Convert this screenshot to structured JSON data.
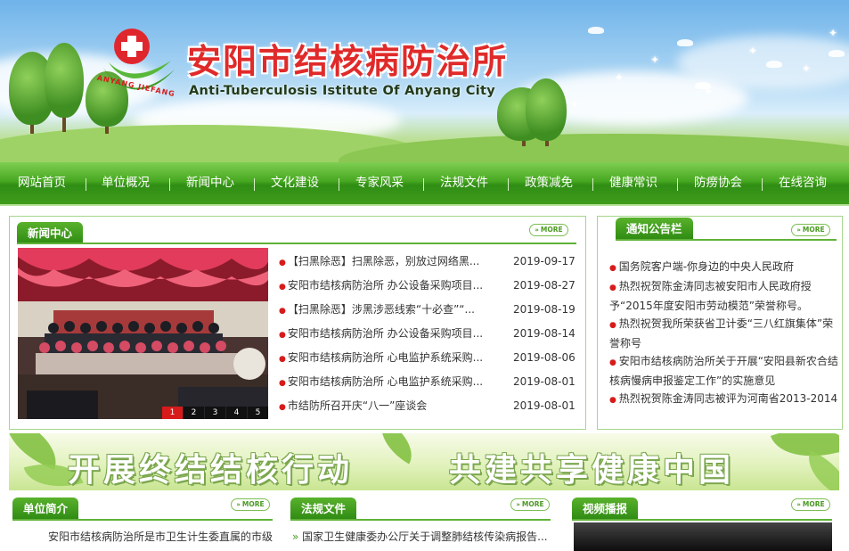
{
  "header": {
    "title": "安阳市结核病防治所",
    "subtitle": "Anti-Tuberculosis Istitute Of Anyang City",
    "logo_ring_text": "ANYANG JIEFANG",
    "colors": {
      "title_red": "#e02a2a",
      "nav_green": "#3f9c1c"
    }
  },
  "nav": {
    "items": [
      {
        "label": "网站首页"
      },
      {
        "label": "单位概况"
      },
      {
        "label": "新闻中心"
      },
      {
        "label": "文化建设"
      },
      {
        "label": "专家风采"
      },
      {
        "label": "法规文件"
      },
      {
        "label": "政策减免"
      },
      {
        "label": "健康常识"
      },
      {
        "label": "防痨协会"
      },
      {
        "label": "在线咨询"
      }
    ]
  },
  "more_label": "MORE",
  "news": {
    "title": "新闻中心",
    "slide_numbers": [
      "1",
      "2",
      "3",
      "4",
      "5"
    ],
    "active_slide": "1",
    "items": [
      {
        "title": "【扫黑除恶】扫黑除恶，别放过网络黑...",
        "date": "2019-09-17"
      },
      {
        "title": "安阳市结核病防治所 办公设备采购项目...",
        "date": "2019-08-27"
      },
      {
        "title": "【扫黑除恶】涉黑涉恶线索“十必查”“...",
        "date": "2019-08-19"
      },
      {
        "title": "安阳市结核病防治所 办公设备采购项目...",
        "date": "2019-08-14"
      },
      {
        "title": "安阳市结核病防治所 心电监护系统采购...",
        "date": "2019-08-06"
      },
      {
        "title": "安阳市结核病防治所 心电监护系统采购...",
        "date": "2019-08-01"
      },
      {
        "title": "市结防所召开庆“八一”座谈会",
        "date": "2019-08-01"
      }
    ]
  },
  "notice": {
    "title": "通知公告栏",
    "items": [
      {
        "text": "国务院客户端-你身边的中央人民政府"
      },
      {
        "text": "热烈祝贺陈金涛同志被安阳市人民政府授予“2015年度安阳市劳动模范”荣誉称号。"
      },
      {
        "text": "热烈祝贺我所荣获省卫计委“三八红旗集体”荣誉称号"
      },
      {
        "text": "安阳市结核病防治所关于开展“安阳县新农合结核病慢病申报鉴定工作”的实施意见"
      },
      {
        "text": "热烈祝贺陈金涛同志被评为河南省2013-2014"
      }
    ]
  },
  "slogan": {
    "left": "开展终结结核行动",
    "right": "共建共享健康中国"
  },
  "sections": {
    "intro": {
      "title": "单位简介",
      "text": "安阳市结核病防治所是市卫生计生委直属的市级"
    },
    "laws": {
      "title": "法规文件",
      "text": "国家卫生健康委办公厅关于调整肺结核传染病报告..."
    },
    "video": {
      "title": "视频播报"
    }
  }
}
